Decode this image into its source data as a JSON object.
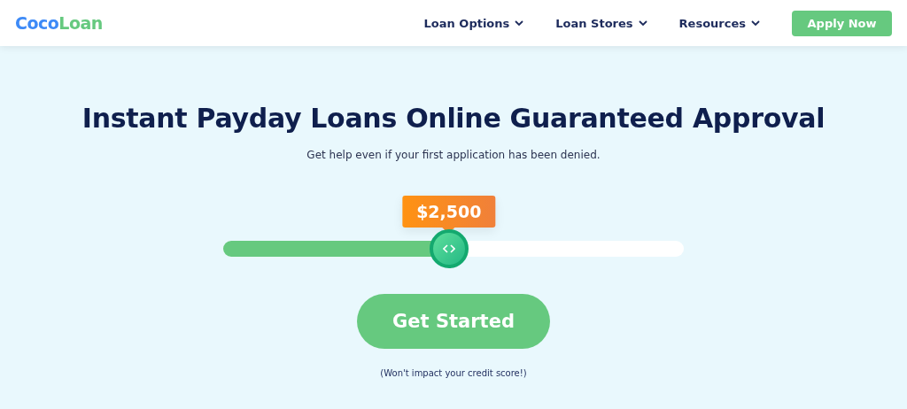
{
  "header": {
    "logo": {
      "first": "Coco",
      "second": "Loan"
    },
    "nav": [
      {
        "label": "Loan Options",
        "dropdown": true
      },
      {
        "label": "Loan Stores",
        "dropdown": true
      },
      {
        "label": "Resources",
        "dropdown": true
      }
    ],
    "cta": "Apply Now"
  },
  "hero": {
    "title": "Instant Payday Loans Online Guaranteed Approval",
    "subtitle": "Get help even if your first application has been denied.",
    "slider": {
      "amount": "$2,500",
      "level": 0.49
    },
    "button": "Get Started",
    "note": "(Won't impact your credit score!)"
  }
}
